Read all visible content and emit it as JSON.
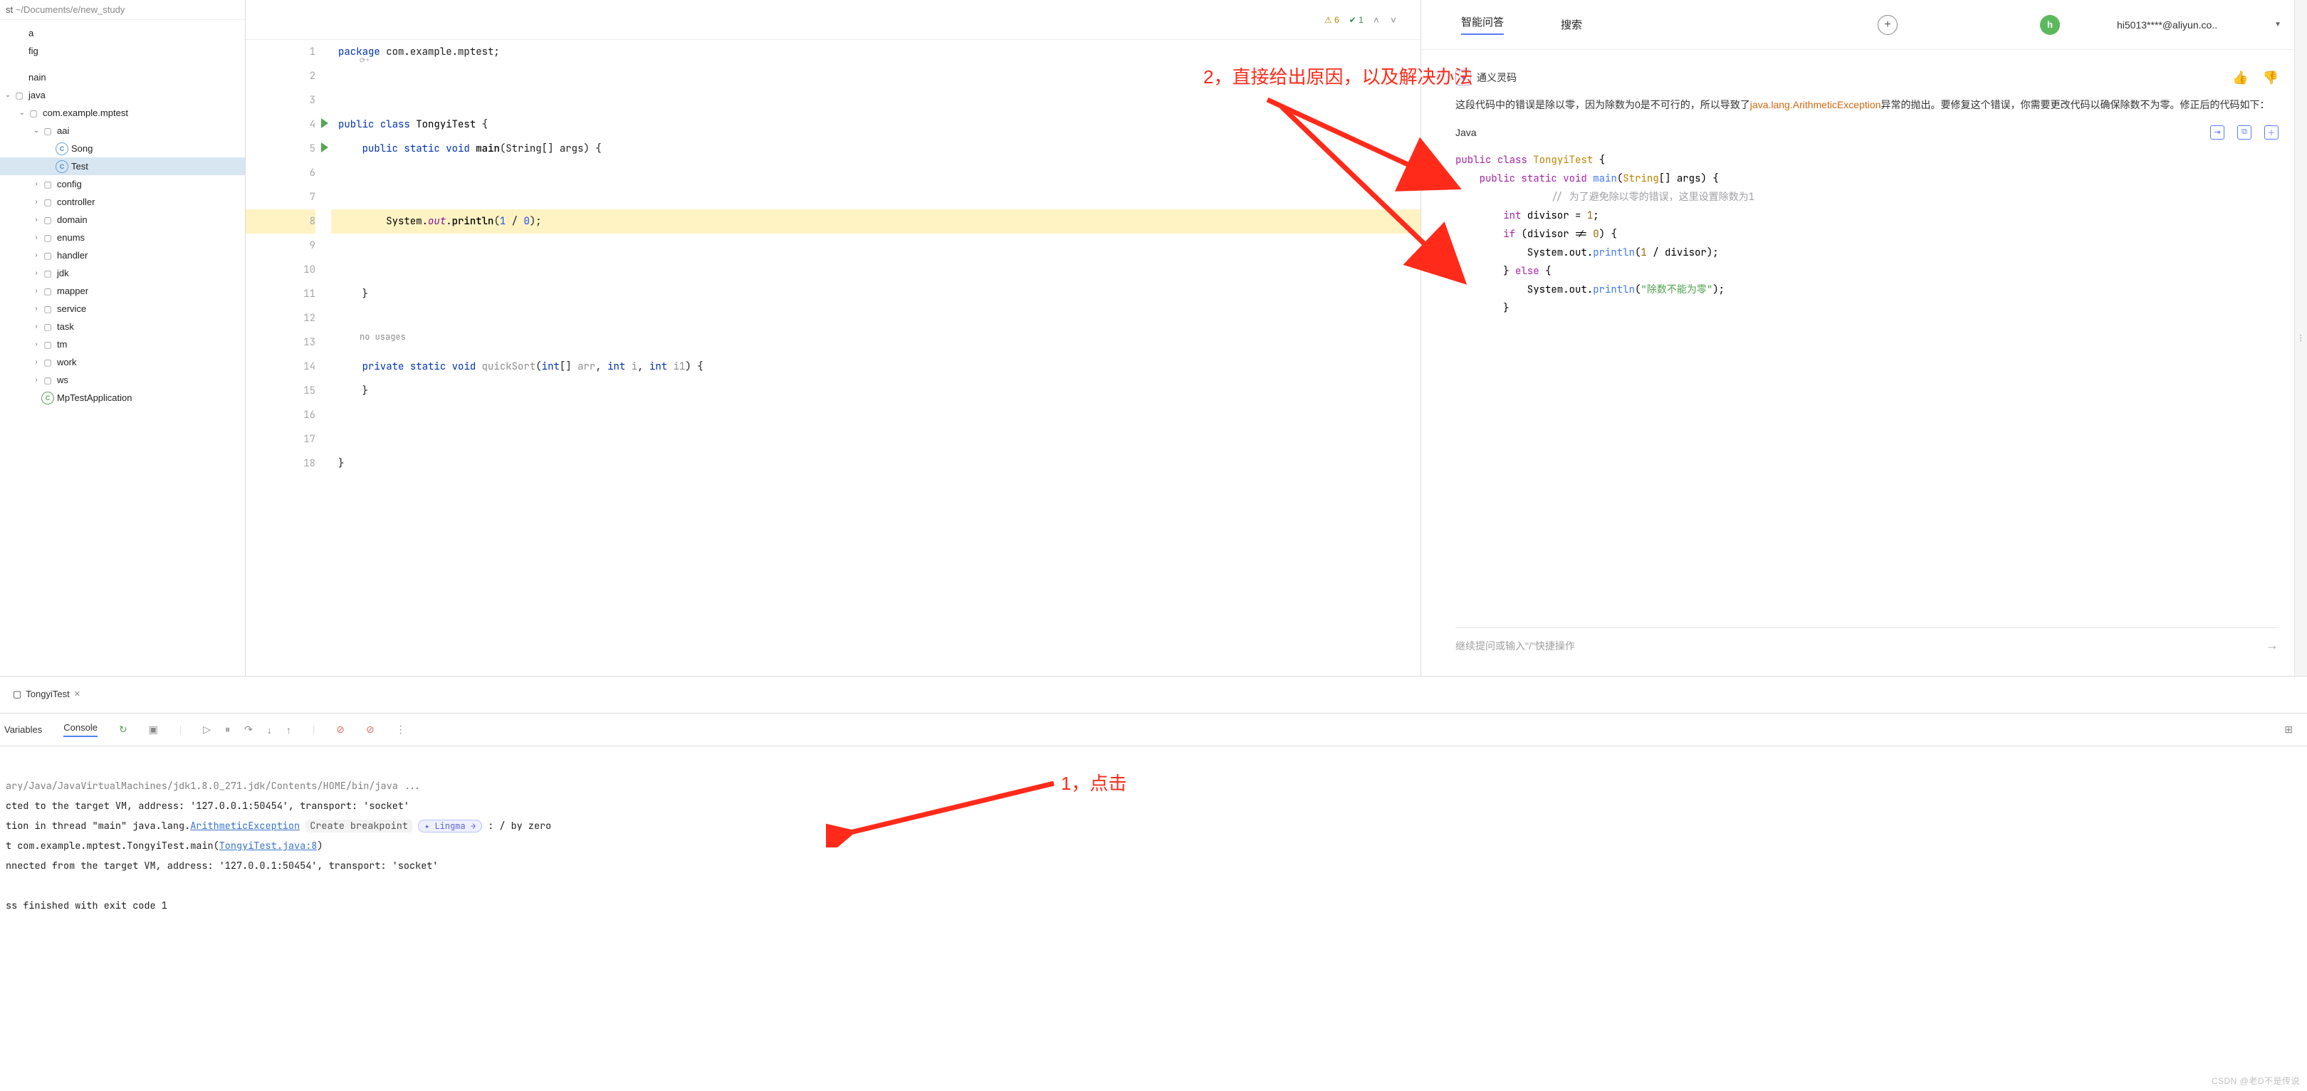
{
  "colors": {
    "accent": "#5b7cfa",
    "warn": "#b38600",
    "ok": "#2e8b57",
    "red_anno": "#ff2a1a"
  },
  "sidebar": {
    "crumbs_prefix": "st",
    "crumbs_path": "~/Documents/e/new_study",
    "nodes": [
      {
        "depth": 0,
        "arrow": "",
        "icon": "",
        "label": "a"
      },
      {
        "depth": 0,
        "arrow": "",
        "icon": "",
        "label": "fig"
      },
      {
        "depth": 0,
        "arrow": "",
        "icon": "",
        "label": ""
      },
      {
        "depth": 0,
        "arrow": "",
        "icon": "",
        "label": "nain"
      },
      {
        "depth": 0,
        "arrow": "v",
        "icon": "pkg",
        "label": "java"
      },
      {
        "depth": 1,
        "arrow": "v",
        "icon": "pkg",
        "label": "com.example.mptest"
      },
      {
        "depth": 2,
        "arrow": "v",
        "icon": "pkg",
        "label": "aai"
      },
      {
        "depth": 3,
        "arrow": "",
        "icon": "cls",
        "label": "Song"
      },
      {
        "depth": 3,
        "arrow": "",
        "icon": "cls",
        "label": "Test",
        "selected": true
      },
      {
        "depth": 2,
        "arrow": ">",
        "icon": "pkg",
        "label": "config"
      },
      {
        "depth": 2,
        "arrow": ">",
        "icon": "pkg",
        "label": "controller"
      },
      {
        "depth": 2,
        "arrow": ">",
        "icon": "pkg",
        "label": "domain"
      },
      {
        "depth": 2,
        "arrow": ">",
        "icon": "pkg",
        "label": "enums"
      },
      {
        "depth": 2,
        "arrow": ">",
        "icon": "pkg",
        "label": "handler"
      },
      {
        "depth": 2,
        "arrow": ">",
        "icon": "pkg",
        "label": "jdk"
      },
      {
        "depth": 2,
        "arrow": ">",
        "icon": "pkg",
        "label": "mapper"
      },
      {
        "depth": 2,
        "arrow": ">",
        "icon": "pkg",
        "label": "service"
      },
      {
        "depth": 2,
        "arrow": ">",
        "icon": "pkg",
        "label": "task"
      },
      {
        "depth": 2,
        "arrow": ">",
        "icon": "pkg",
        "label": "tm"
      },
      {
        "depth": 2,
        "arrow": ">",
        "icon": "pkg",
        "label": "work"
      },
      {
        "depth": 2,
        "arrow": ">",
        "icon": "pkg",
        "label": "ws"
      },
      {
        "depth": 2,
        "arrow": "",
        "icon": "cls_green",
        "label": "MpTestApplication"
      }
    ]
  },
  "editor": {
    "warn_count": "6",
    "ok_count": "1",
    "lines": [
      {
        "n": "1",
        "run": false
      },
      {
        "n": "2",
        "run": false
      },
      {
        "n": "3",
        "run": false
      },
      {
        "n": "4",
        "run": true
      },
      {
        "n": "5",
        "run": true
      },
      {
        "n": "6",
        "run": false
      },
      {
        "n": "7",
        "run": false
      },
      {
        "n": "8",
        "run": false,
        "hl": true
      },
      {
        "n": "9",
        "run": false
      },
      {
        "n": "10",
        "run": false
      },
      {
        "n": "11",
        "run": false
      },
      {
        "n": "12",
        "run": false
      },
      {
        "n": "13",
        "run": false
      },
      {
        "n": "14",
        "run": false
      },
      {
        "n": "15",
        "run": false
      },
      {
        "n": "16",
        "run": false
      },
      {
        "n": "17",
        "run": false
      },
      {
        "n": "18",
        "run": false
      }
    ],
    "no_usages": "no usages",
    "tokens": {
      "package": "package",
      "pkg_name": "com.example.mptest",
      "public": "public",
      "class": "class",
      "cls_name": "TongyiTest",
      "static": "static",
      "void": "void",
      "main": "main",
      "String": "String",
      "args": "args",
      "System": "System",
      "out": "out",
      "println": "println",
      "one": "1",
      "zero": "0",
      "private": "private",
      "quickSort": "quickSort",
      "int": "int",
      "arr": "arr",
      "i": "i",
      "i1": "i1"
    }
  },
  "assistant": {
    "tabs": {
      "qa": "智能问答",
      "search": "搜索"
    },
    "user": "hi5013****@aliyun.co..",
    "bot_name": "通义灵码",
    "message_pre": "这段代码中的错误是除以零，因为除数为0是不可行的，所以导致了",
    "message_exc": "java.lang.ArithmeticException",
    "message_post": "异常的抛出。要修复这个错误，你需要更改代码以确保除数不为零。修正后的代码如下：",
    "code_lang": "Java",
    "code": {
      "l1": "public class TongyiTest {",
      "l2": "    public static void main(String[] args) {",
      "l3": "        // 为了避免除以零的错误，这里设置除数为1",
      "l4": "        int divisor = 1;",
      "l5": "        if (divisor != 0) {",
      "l6": "            System.out.println(1 / divisor);",
      "l7": "        } else {",
      "l8": "            System.out.println(\"除数不能为零\");",
      "l9": "        }"
    },
    "input_placeholder": "继续提问或输入\"/\"快捷操作"
  },
  "run": {
    "tab": "TongyiTest",
    "subtabs": {
      "vars": "Variables",
      "console": "Console"
    },
    "lines": {
      "l1": "ary/Java/JavaVirtualMachines/jdk1.8.0_271.jdk/Contents/HOME/bin/java ...",
      "l2": "cted to the target VM, address: '127.0.0.1:50454', transport: 'socket'",
      "l3a": "tion in thread \"main\" java.lang.",
      "l3link": "ArithmeticException",
      "l3badge": "Create breakpoint",
      "l3pill": "Lingma →",
      "l3b": ": / by zero",
      "l4a": "t com.example.mptest.TongyiTest.main(",
      "l4link": "TongyiTest.java:8",
      "l4b": ")",
      "l5": "nnected from the target VM, address: '127.0.0.1:50454', transport: 'socket'",
      "l6": "ss finished with exit code 1"
    }
  },
  "annotations": {
    "a1": "1，点击",
    "a2": "2，直接给出原因，以及解决办法"
  },
  "watermark": "CSDN @老D不是传说"
}
